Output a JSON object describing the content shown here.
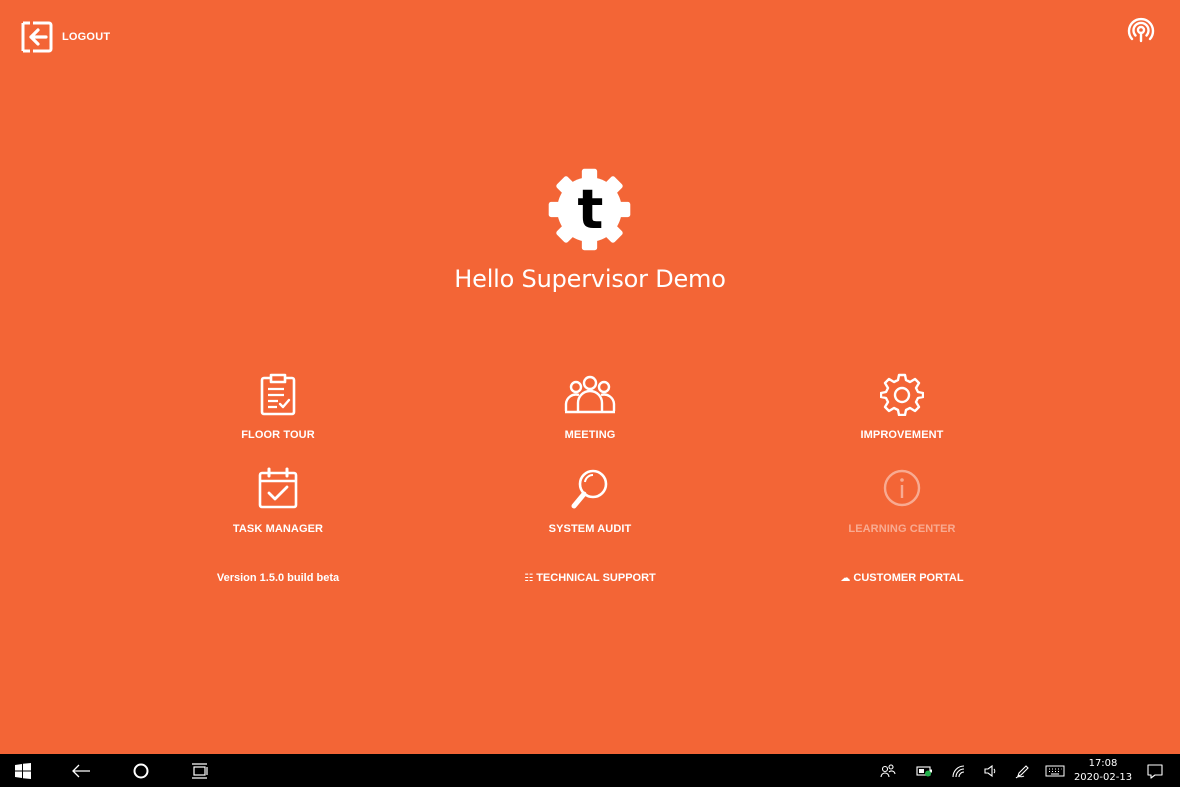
{
  "header": {
    "logout_label": "LOGOUT",
    "logout_icon": "logout-arrow-icon",
    "broadcast_icon": "broadcast-icon"
  },
  "brand": {
    "logo_letter": "t",
    "logo_icon": "gear-logo-icon",
    "greeting": "Hello Supervisor Demo"
  },
  "tiles": [
    {
      "label": "FLOOR TOUR",
      "icon": "clipboard-checklist-icon",
      "enabled": true
    },
    {
      "label": "MEETING",
      "icon": "people-group-icon",
      "enabled": true
    },
    {
      "label": "IMPROVEMENT",
      "icon": "gear-icon",
      "enabled": true
    },
    {
      "label": "TASK MANAGER",
      "icon": "calendar-check-icon",
      "enabled": true
    },
    {
      "label": "SYSTEM AUDIT",
      "icon": "magnifier-icon",
      "enabled": true
    },
    {
      "label": "LEARNING CENTER",
      "icon": "info-icon",
      "enabled": false
    }
  ],
  "footer": {
    "version": "Version 1.5.0 build beta",
    "technical_support": "TECHNICAL SUPPORT",
    "technical_support_icon": "sliders-icon",
    "customer_portal": "CUSTOMER PORTAL",
    "customer_portal_icon": "cloud-icon"
  },
  "taskbar": {
    "time": "17:08",
    "date": "2020-02-13"
  },
  "colors": {
    "background": "#f36536",
    "foreground": "#ffffff",
    "taskbar": "#000000"
  }
}
